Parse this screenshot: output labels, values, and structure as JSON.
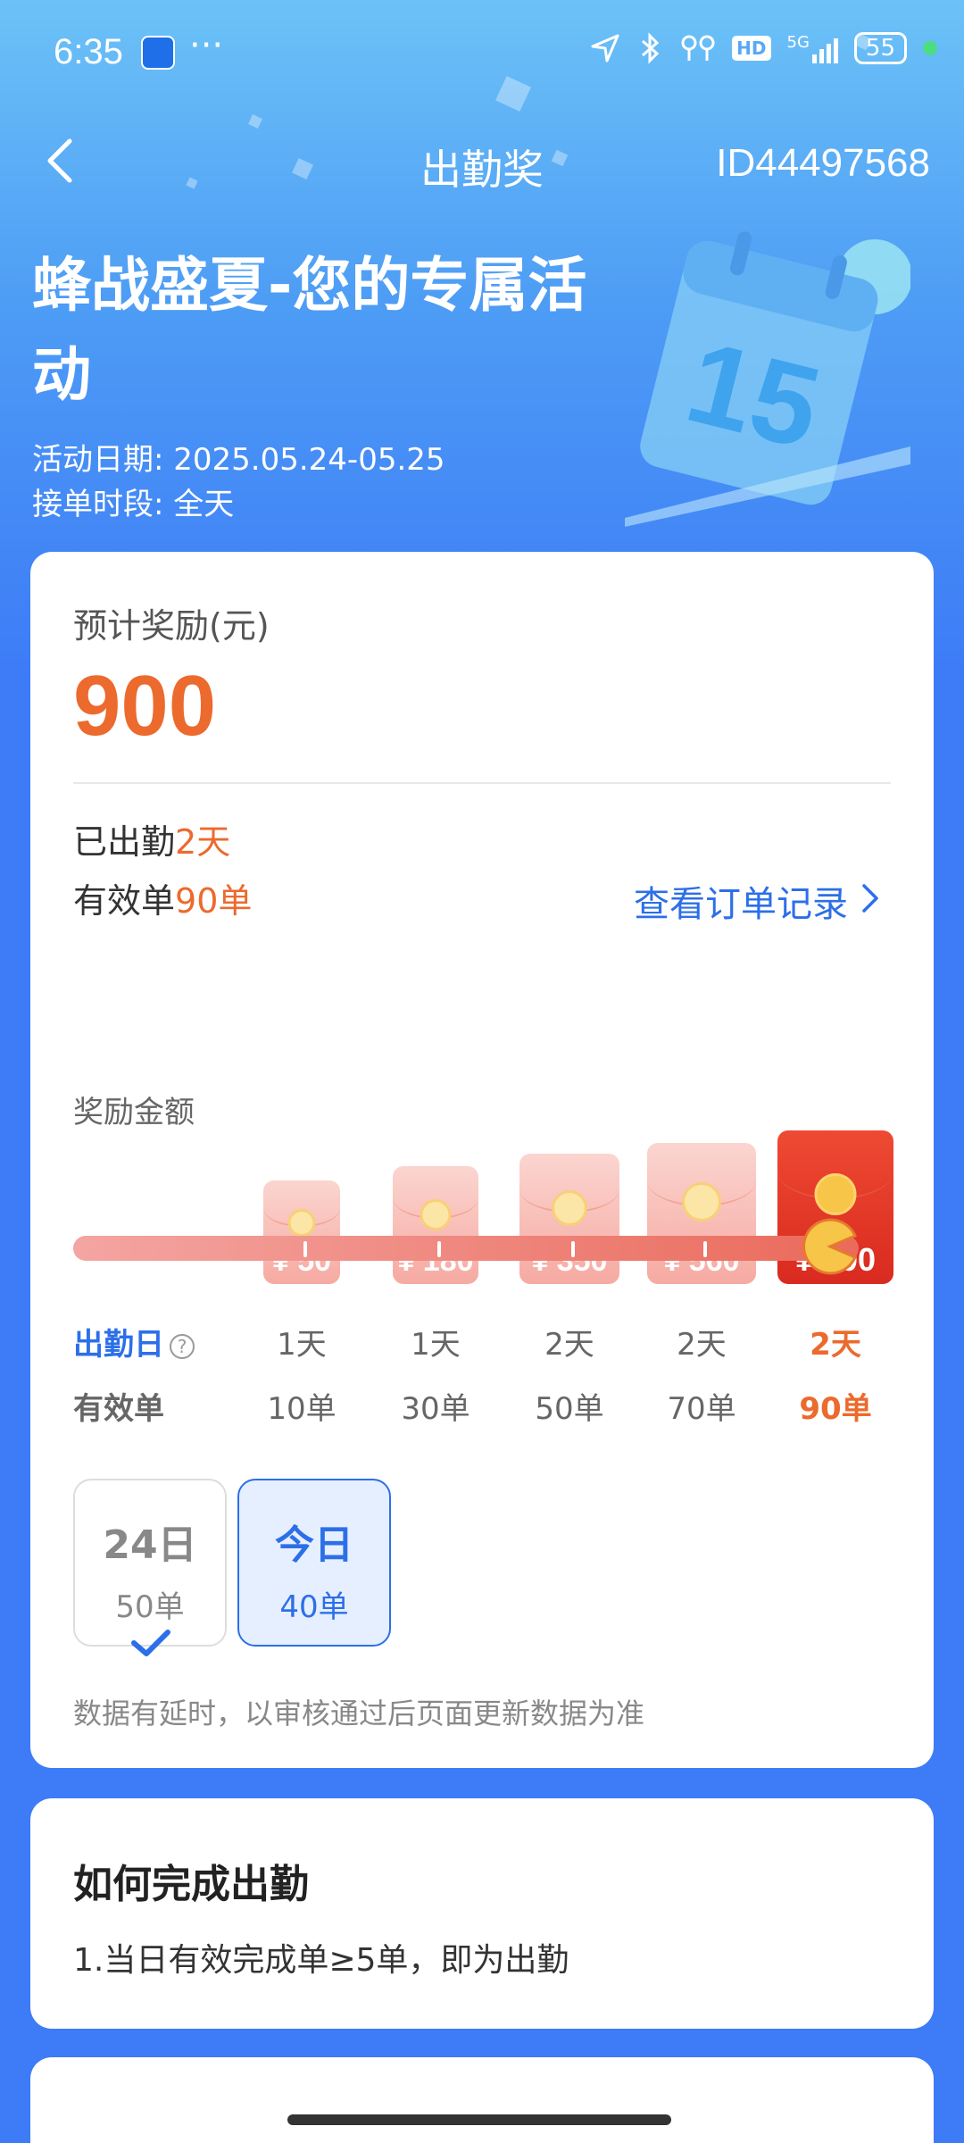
{
  "status_bar": {
    "time": "6:35",
    "dots": "···",
    "network": "5G",
    "hd": "HD",
    "battery": "55"
  },
  "nav": {
    "title": "出勤奖",
    "id": "ID44497568"
  },
  "hero": {
    "title": "蜂战盛夏-您的专属活动",
    "date_label": "活动日期: ",
    "date_value": "2025.05.24-05.25",
    "time_label": "接单时段: ",
    "time_value": "全天",
    "calendar_number": "15"
  },
  "summary": {
    "expected_label": "预计奖励(元)",
    "expected_amount": "900",
    "attended_prefix": "已出勤",
    "attended_value": "2天",
    "valid_prefix": "有效单",
    "valid_value": "90单",
    "order_link": "查看订单记录"
  },
  "rewards": {
    "label": "奖励金额",
    "currency": "¥",
    "tiers": [
      {
        "amount": "50",
        "days": "1天",
        "orders": "10单"
      },
      {
        "amount": "180",
        "days": "1天",
        "orders": "30单"
      },
      {
        "amount": "350",
        "days": "2天",
        "orders": "50单"
      },
      {
        "amount": "560",
        "days": "2天",
        "orders": "70单"
      },
      {
        "amount": "900",
        "days": "2天",
        "orders": "90单"
      }
    ],
    "progress_fraction": 1.0,
    "days_row_label": "出勤日",
    "help_glyph": "?",
    "orders_row_label": "有效单"
  },
  "day_tabs": [
    {
      "day": "24日",
      "orders": "50单"
    },
    {
      "day": "今日",
      "orders": "40单"
    }
  ],
  "note": "数据有延时，以审核通过后页面更新数据为准",
  "howto": {
    "title": "如何完成出勤",
    "rule1": "1.当日有效完成单≥5单，即为出勤"
  },
  "colors": {
    "accent": "#2c6fe8",
    "orange": "#ec6a2d",
    "red_envelope": "#e23a2a"
  }
}
